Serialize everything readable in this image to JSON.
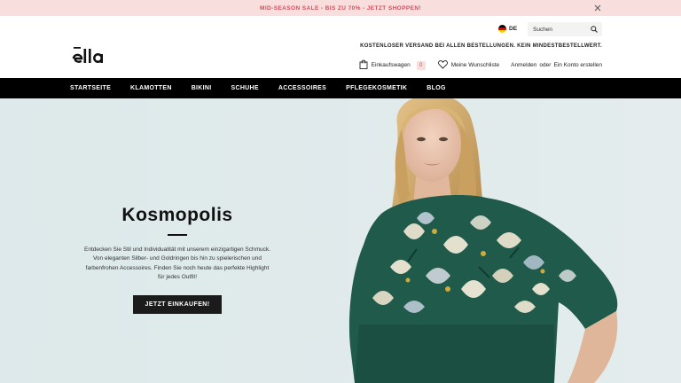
{
  "announcement": {
    "text": "MID-SEASON SALE - BIS ZU 70% - JETZT SHOPPEN!"
  },
  "header": {
    "logo_text": "ella",
    "language": "DE",
    "search_placeholder": "Suchen",
    "shipping_notice": "KOSTENLOSER VERSAND BEI ALLEN BESTELLUNGEN. KEIN MINDESTBESTELLWERT.",
    "cart_label": "Einkaufswagen",
    "cart_count": "0",
    "wishlist_label": "Meine Wunschliste",
    "login_label": "Anmelden",
    "login_or": "oder",
    "register_label": "Ein Konto erstellen"
  },
  "nav": {
    "items": [
      {
        "label": "STARTSEITE"
      },
      {
        "label": "KLAMOTTEN"
      },
      {
        "label": "BIKINI"
      },
      {
        "label": "SCHUHE"
      },
      {
        "label": "ACCESSOIRES"
      },
      {
        "label": "PFLEGEKOSMETIK"
      },
      {
        "label": "BLOG"
      }
    ]
  },
  "hero": {
    "title": "Kosmopolis",
    "description": "Entdecken Sie Stil und Individualität mit unserem einzigartigen Schmuck. Von eleganten Silber- und Goldringen bis hin zu spielerischen und farbenfrohen Accessoires. Finden Sie noch heute das perfekte Highlight für jedes Outfit!",
    "cta_label": "JETZT EINKAUFEN!"
  },
  "colors": {
    "announcement_bg": "#f8dedd",
    "announcement_text": "#d2505c",
    "nav_bg": "#000000",
    "hero_bg": "#dfeaea",
    "dress_green": "#1f5a4a"
  },
  "icons": {
    "close": "close-icon",
    "flag": "german-flag-icon",
    "search": "search-icon",
    "cart": "shopping-bag-icon",
    "wishlist": "heart-icon"
  }
}
